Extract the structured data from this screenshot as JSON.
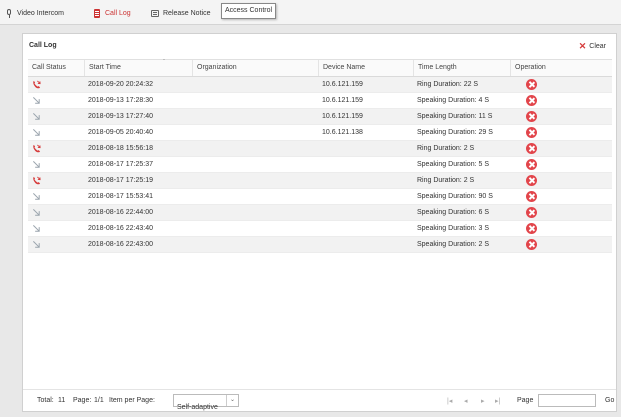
{
  "tabs": [
    {
      "label": "Video Intercom",
      "icon": "microphone-icon",
      "active": false
    },
    {
      "label": "Call Log",
      "icon": "call-log-icon",
      "active": true
    },
    {
      "label": "Release Notice",
      "icon": "notice-icon",
      "active": false
    }
  ],
  "tooltip": "Access Control",
  "panel": {
    "title": "Call Log",
    "clear_label": "Clear"
  },
  "table": {
    "columns": [
      "Call Status",
      "Start Time",
      "Organization",
      "Device Name",
      "Time Length",
      "Operation"
    ],
    "rows": [
      {
        "status": "missed",
        "start": "2018-09-20 20:24:32",
        "org": "",
        "device": "10.6.121.159",
        "length": "Ring Duration: 22 S"
      },
      {
        "status": "outgoing",
        "start": "2018-09-13 17:28:30",
        "org": "",
        "device": "10.6.121.159",
        "length": "Speaking Duration: 4 S"
      },
      {
        "status": "outgoing",
        "start": "2018-09-13 17:27:40",
        "org": "",
        "device": "10.6.121.159",
        "length": "Speaking Duration: 11 S"
      },
      {
        "status": "outgoing",
        "start": "2018-09-05 20:40:40",
        "org": "",
        "device": "10.6.121.138",
        "length": "Speaking Duration: 29 S"
      },
      {
        "status": "missed",
        "start": "2018-08-18 15:56:18",
        "org": "",
        "device": "",
        "length": "Ring Duration: 2 S"
      },
      {
        "status": "outgoing",
        "start": "2018-08-17 17:25:37",
        "org": "",
        "device": "",
        "length": "Speaking Duration: 5 S"
      },
      {
        "status": "missed",
        "start": "2018-08-17 17:25:19",
        "org": "",
        "device": "",
        "length": "Ring Duration: 2 S"
      },
      {
        "status": "outgoing",
        "start": "2018-08-17 15:53:41",
        "org": "",
        "device": "",
        "length": "Speaking Duration: 90 S"
      },
      {
        "status": "outgoing",
        "start": "2018-08-16 22:44:00",
        "org": "",
        "device": "",
        "length": "Speaking Duration: 6 S"
      },
      {
        "status": "outgoing",
        "start": "2018-08-16 22:43:40",
        "org": "",
        "device": "",
        "length": "Speaking Duration: 3 S"
      },
      {
        "status": "outgoing",
        "start": "2018-08-16 22:43:00",
        "org": "",
        "device": "",
        "length": "Speaking Duration: 2 S"
      }
    ]
  },
  "footer": {
    "total_label": "Total:",
    "total_value": "11",
    "page_label": "Page:",
    "page_value": "1/1",
    "per_page_label": "Item per Page:",
    "per_page_value": "Self-adaptive",
    "goto_page_label": "Page",
    "go_label": "Go"
  },
  "colors": {
    "missed": "#d63a3a",
    "outgoing": "#9aa4ad",
    "delete": "#e2454b",
    "active_tab": "#cc3333"
  }
}
